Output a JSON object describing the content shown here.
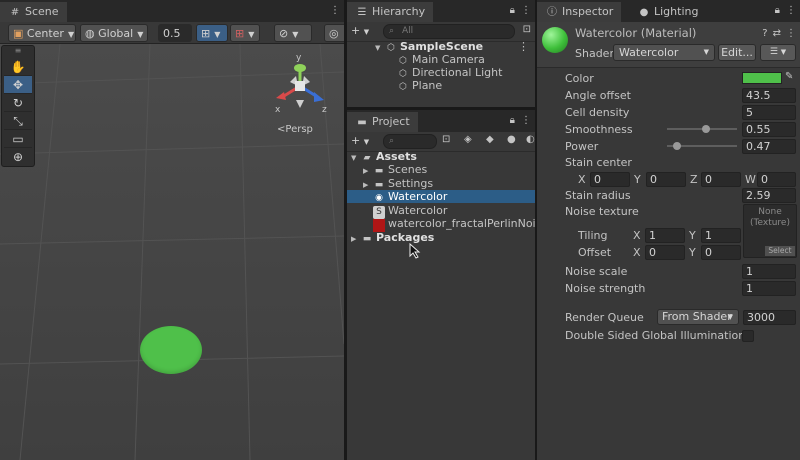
{
  "scene": {
    "tab": "Scene",
    "toolbar": {
      "pivot": "Center",
      "space": "Global",
      "snap_value": "0.5"
    },
    "view_label": "Persp",
    "gizmo": {
      "y": "y",
      "x": "x",
      "z": "z"
    },
    "tools": [
      "hand-tool",
      "move-tool",
      "rotate-tool",
      "scale-tool",
      "rect-tool",
      "transform-tool"
    ],
    "material_color": "#4fc04a"
  },
  "hierarchy": {
    "tab": "Hierarchy",
    "search_placeholder": "All",
    "scene_name": "SampleScene",
    "items": [
      "Main Camera",
      "Directional Light",
      "Plane"
    ]
  },
  "project": {
    "tab": "Project",
    "assets_label": "Assets",
    "items": [
      {
        "label": "Scenes",
        "type": "folder"
      },
      {
        "label": "Settings",
        "type": "folder"
      },
      {
        "label": "Watercolor",
        "type": "material",
        "selected": true
      },
      {
        "label": "Watercolor",
        "type": "shader"
      },
      {
        "label": "watercolor_fractalPerlinNoise",
        "type": "texture"
      }
    ],
    "packages_label": "Packages"
  },
  "inspector": {
    "tab_inspector": "Inspector",
    "tab_lighting": "Lighting",
    "material_title": "Watercolor (Material)",
    "shader_label": "Shader",
    "shader_value": "Watercolor",
    "edit_label": "Edit...",
    "props": {
      "color_label": "Color",
      "angle_offset_label": "Angle offset",
      "angle_offset": "43.5",
      "cell_density_label": "Cell density",
      "cell_density": "5",
      "smoothness_label": "Smoothness",
      "smoothness": "0.55",
      "power_label": "Power",
      "power": "0.47",
      "stain_center_label": "Stain center",
      "stain_center": {
        "x": "0",
        "y": "0",
        "z": "0",
        "w": "0"
      },
      "stain_radius_label": "Stain radius",
      "stain_radius": "2.59",
      "noise_texture_label": "Noise texture",
      "texture_slot": "None\n(Texture)",
      "texture_select": "Select",
      "tiling_label": "Tiling",
      "tiling": {
        "x": "1",
        "y": "1"
      },
      "offset_label": "Offset",
      "offset": {
        "x": "0",
        "y": "0"
      },
      "noise_scale_label": "Noise scale",
      "noise_scale": "1",
      "noise_strength_label": "Noise strength",
      "noise_strength": "1",
      "render_queue_label": "Render Queue",
      "render_queue_mode": "From Shader",
      "render_queue_value": "3000",
      "double_sided_label": "Double Sided Global Illumination"
    },
    "axis_labels": {
      "x": "X",
      "y": "Y",
      "z": "Z",
      "w": "W"
    }
  }
}
